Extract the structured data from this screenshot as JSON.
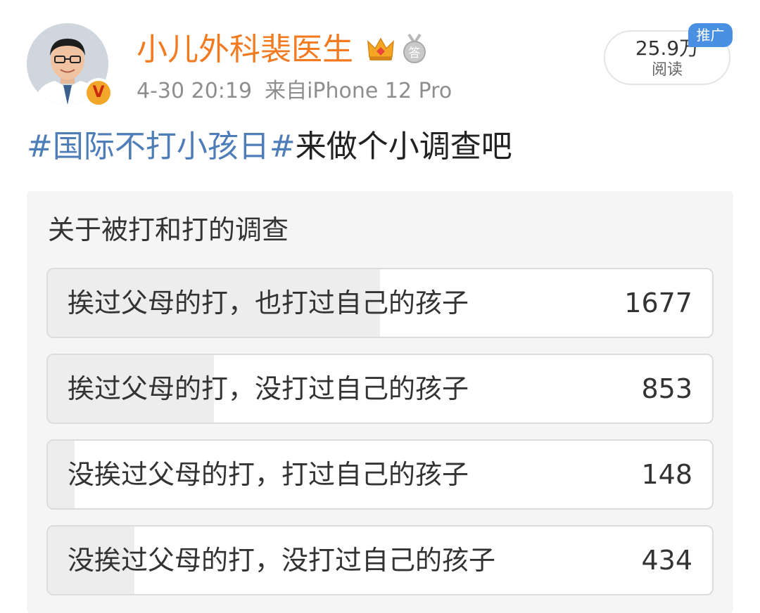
{
  "post": {
    "author": "小儿外科裴医生",
    "date": "4-30 20:19",
    "source": "来自iPhone 12 Pro",
    "reads": {
      "count": "25.9万",
      "unit": "阅读"
    },
    "promo_tag": "推广",
    "topic": "#国际不打小孩日#",
    "text": "来做个小调查吧",
    "icons": [
      "avatar",
      "verified-v-icon",
      "crown-icon",
      "medal-icon"
    ]
  },
  "poll": {
    "title": "关于被打和打的调查",
    "options": [
      {
        "label": "挨过父母的打，也打过自己的孩子",
        "votes": "1677",
        "fill_fraction": 0.5
      },
      {
        "label": "挨过父母的打，没打过自己的孩子",
        "votes": "853",
        "fill_fraction": 0.25
      },
      {
        "label": "没挨过父母的打，打过自己的孩子",
        "votes": "148",
        "fill_fraction": 0.04
      },
      {
        "label": "没挨过父母的打，没打过自己的孩子",
        "votes": "434",
        "fill_fraction": 0.13
      }
    ]
  },
  "colors": {
    "username": "#f27a21",
    "topic": "#4f7db8",
    "meta": "#8e8e8e",
    "promo_tag": "#4a90e2",
    "poll_fill": "#ededed",
    "card_bg": "#f5f5f5"
  }
}
